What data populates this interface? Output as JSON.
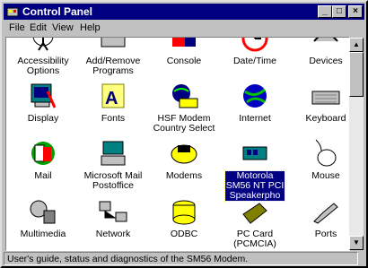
{
  "window": {
    "title": "Control Panel",
    "title_icon": "control-panel-icon"
  },
  "titlebar_buttons": {
    "minimize": "_",
    "maximize": "□",
    "close": "×"
  },
  "menubar": {
    "file": "File",
    "edit": "Edit",
    "view": "View",
    "help": "Help"
  },
  "items": [
    {
      "label": "Accessibility\nOptions",
      "icon": "accessibility-icon"
    },
    {
      "label": "Add/Remove\nPrograms",
      "icon": "add-remove-programs-icon"
    },
    {
      "label": "Console",
      "icon": "console-icon"
    },
    {
      "label": "Date/Time",
      "icon": "date-time-icon"
    },
    {
      "label": "Devices",
      "icon": "devices-icon"
    },
    {
      "label": "Display",
      "icon": "display-icon"
    },
    {
      "label": "Fonts",
      "icon": "fonts-icon"
    },
    {
      "label": "HSF Modem\nCountry Select",
      "icon": "hsf-modem-icon"
    },
    {
      "label": "Internet",
      "icon": "internet-icon"
    },
    {
      "label": "Keyboard",
      "icon": "keyboard-icon"
    },
    {
      "label": "Mail",
      "icon": "mail-icon"
    },
    {
      "label": "Microsoft Mail\nPostoffice",
      "icon": "mail-postoffice-icon"
    },
    {
      "label": "Modems",
      "icon": "modems-icon"
    },
    {
      "label": "Motorola\nSM56 NT PCI\nSpeakerpho",
      "icon": "motorola-modem-icon",
      "selected": true
    },
    {
      "label": "Mouse",
      "icon": "mouse-icon"
    },
    {
      "label": "Multimedia",
      "icon": "multimedia-icon"
    },
    {
      "label": "Network",
      "icon": "network-icon"
    },
    {
      "label": "ODBC",
      "icon": "odbc-icon"
    },
    {
      "label": "PC Card\n(PCMCIA)",
      "icon": "pc-card-icon"
    },
    {
      "label": "Ports",
      "icon": "ports-icon"
    }
  ],
  "scrollbar": {
    "up": "▲",
    "down": "▼"
  },
  "statusbar": {
    "text": "User's guide, status and diagnostics of the SM56 Modem."
  }
}
